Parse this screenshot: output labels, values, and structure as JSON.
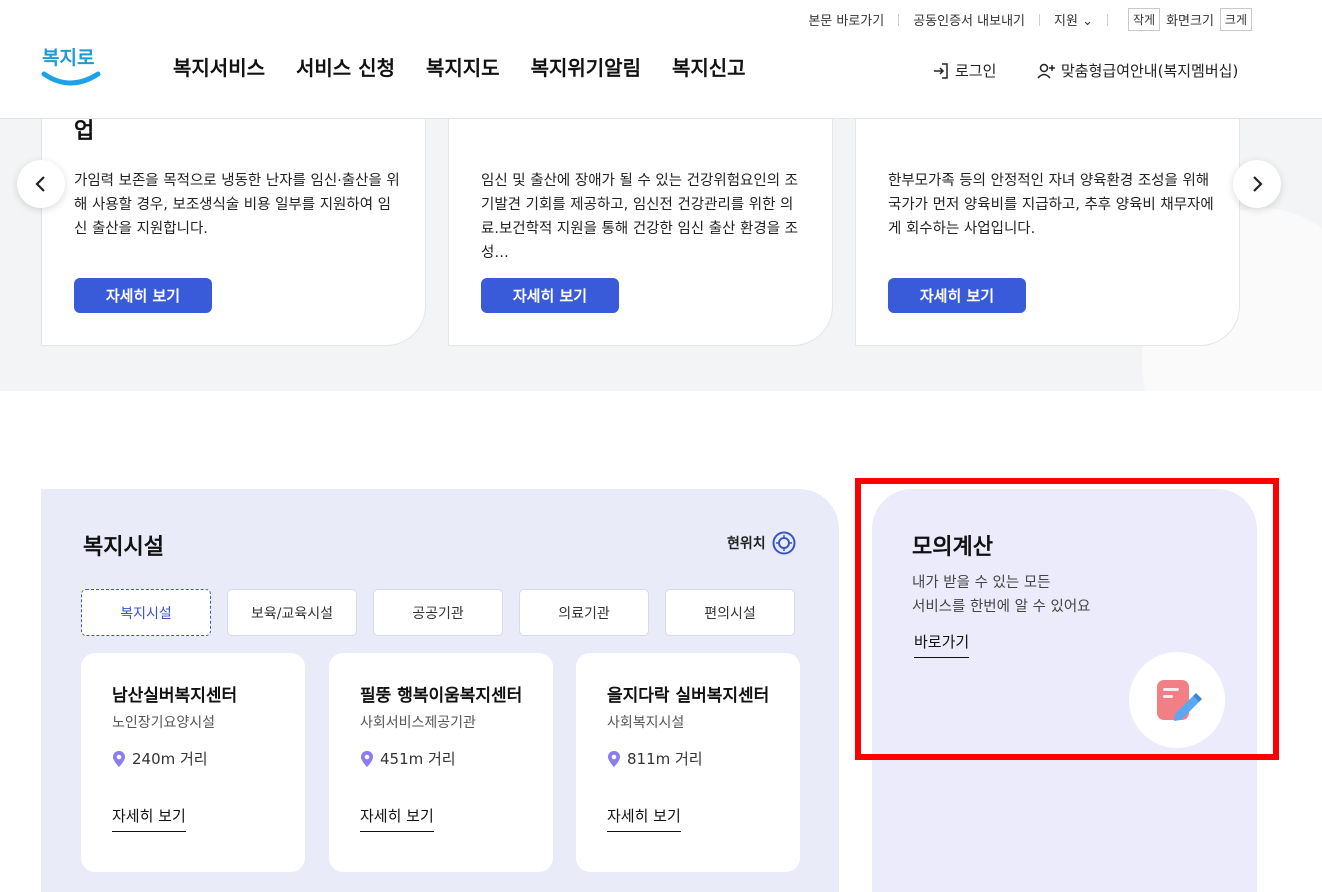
{
  "header": {
    "util": {
      "skip": "본문 바로가기",
      "cert": "공동인증서 내보내기",
      "support": "지원",
      "small": "작게",
      "screen_size": "화면크기",
      "large": "크게"
    },
    "logo_text": "복지로",
    "nav": [
      "복지서비스",
      "서비스 신청",
      "복지지도",
      "복지위기알림",
      "복지신고"
    ],
    "login": "로그인",
    "member": "맞춤형급여안내(복지멤버십)"
  },
  "carousel": {
    "cards": [
      {
        "title_line2": "업",
        "desc": "가임력 보존을 목적으로 냉동한 난자를 임신·출산을 위해 사용할 경우, 보조생식술 비용 일부를 지원하여 임신 출산을 지원합니다.",
        "button": "자세히 보기"
      },
      {
        "desc": "임신 및 출산에 장애가 될 수 있는 건강위험요인의 조기발견 기회를 제공하고, 임신전 건강관리를 위한 의료.보건학적 지원을 통해 건강한 임신 출산 환경을 조성…",
        "button": "자세히 보기"
      },
      {
        "desc": "한부모가족 등의 안정적인 자녀 양육환경 조성을 위해 국가가 먼저 양육비를 지급하고, 추후 양육비 채무자에게 회수하는 사업입니다.",
        "button": "자세히 보기"
      }
    ]
  },
  "facilities": {
    "title": "복지시설",
    "location": "현위치",
    "tabs": [
      "복지시설",
      "보육/교육시설",
      "공공기관",
      "의료기관",
      "편의시설"
    ],
    "active_tab": "복지시설",
    "items": [
      {
        "name": "남산실버복지센터",
        "type": "노인장기요양시설",
        "distance": "240m 거리",
        "link": "자세히 보기"
      },
      {
        "name": "필뚱 행복이움복지센터",
        "type": "사회서비스제공기관",
        "distance": "451m 거리",
        "link": "자세히 보기"
      },
      {
        "name": "을지다락 실버복지센터",
        "type": "사회복지시설",
        "distance": "811m 거리",
        "link": "자세히 보기"
      }
    ]
  },
  "calc": {
    "title": "모의계산",
    "desc_line1": "내가 받을 수 있는 모든",
    "desc_line2": "서비스를 한번에 알 수 있어요",
    "link": "바로가기"
  },
  "colors": {
    "primary_button": "#3a5bd9",
    "facility_bg": "#e9ecf8",
    "calc_bg": "#ecebfb",
    "pin": "#8b7cf0",
    "highlight": "#ff0000"
  }
}
